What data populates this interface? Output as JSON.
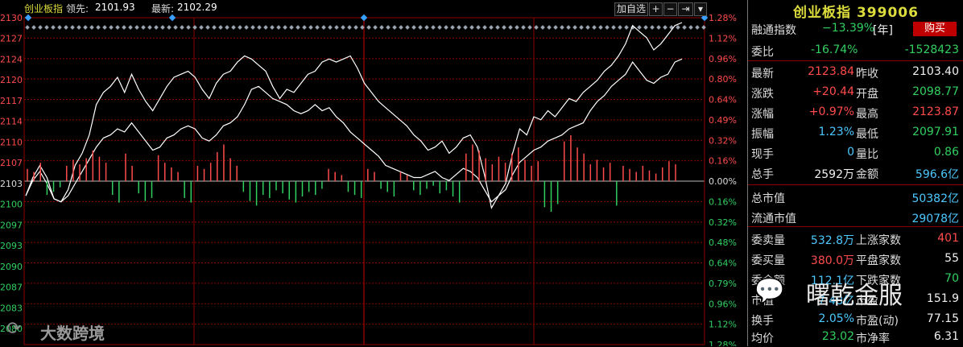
{
  "header": {
    "index_name": "创业板指",
    "leader_label": "领先:",
    "leader_value": "2101.93",
    "latest_label": "最新:",
    "latest_value": "2102.29",
    "add_button": "加自选",
    "plus_button": "+",
    "minus_button": "−",
    "next_button": "⇥",
    "dropdown_button": "▾"
  },
  "chart_data": {
    "type": "line",
    "title": "",
    "prev_close": 2103.4,
    "y_left_ticks": [
      "2130",
      "2127",
      "2124",
      "2120",
      "2117",
      "2114",
      "2110",
      "2107",
      "2103",
      "2100",
      "2097",
      "2093",
      "2090",
      "2087",
      "2083",
      "2080"
    ],
    "y_right_ticks": [
      "1.28%",
      "1.12%",
      "0.96%",
      "0.80%",
      "0.64%",
      "0.49%",
      "0.32%",
      "0.16%",
      "0.00%",
      "0.16%",
      "0.32%",
      "0.48%",
      "0.64%",
      "0.79%",
      "0.96%",
      "1.12%",
      "1.28%"
    ],
    "ylim": [
      2076.5,
      2130.3
    ],
    "x_count": 240,
    "series": [
      {
        "name": "",
        "color": "#ffffff",
        "values": [
          2101.0,
          2104.0,
          2106.0,
          2104.0,
          2100.5,
          2100.0,
          2102.0,
          2106.0,
          2108.0,
          2111.0,
          2116.0,
          2118.0,
          2119.0,
          2120.5,
          2118.0,
          2121.0,
          2118.5,
          2116.5,
          2115.0,
          2117.0,
          2119.0,
          2120.5,
          2121.0,
          2121.5,
          2120.5,
          2118.5,
          2117.0,
          2119.5,
          2121.0,
          2121.5,
          2123.0,
          2124.0,
          2123.5,
          2122.5,
          2121.5,
          2119.0,
          2117.0,
          2118.5,
          2118.0,
          2119.5,
          2121.0,
          2121.5,
          2123.0,
          2123.5,
          2123.0,
          2123.5,
          2124.0,
          2122.0,
          2119.5,
          2118.0,
          2116.5,
          2115.5,
          2114.5,
          2113.5,
          2112.5,
          2111.0,
          2110.0,
          2108.5,
          2109.0,
          2110.0,
          2108.0,
          2109.0,
          2110.5,
          2111.0,
          2109.0,
          2104.5,
          2099.0,
          2101.0,
          2103.0,
          2108.0,
          2112.0,
          2111.0,
          2114.0,
          2113.5,
          2115.0,
          2114.0,
          2115.5,
          2117.0,
          2116.5,
          2118.0,
          2119.0,
          2120.0,
          2121.5,
          2122.5,
          2124.0,
          2126.0,
          2129.0,
          2128.0,
          2127.0,
          2125.0,
          2126.0,
          2127.5,
          2129.0,
          2129.5
        ]
      },
      {
        "name": "",
        "color": "#ffffff",
        "values": [
          2101.0,
          2103.5,
          2105.0,
          2103.0,
          2100.5,
          2100.0,
          2101.0,
          2103.0,
          2105.0,
          2107.0,
          2109.0,
          2110.5,
          2111.0,
          2112.0,
          2111.5,
          2113.0,
          2111.5,
          2110.0,
          2108.5,
          2109.0,
          2110.5,
          2111.0,
          2112.0,
          2112.5,
          2112.0,
          2110.5,
          2110.0,
          2111.0,
          2112.5,
          2113.0,
          2114.0,
          2116.0,
          2118.5,
          2119.0,
          2118.0,
          2117.0,
          2116.5,
          2116.0,
          2115.0,
          2114.5,
          2115.0,
          2116.0,
          2115.0,
          2115.5,
          2114.0,
          2113.0,
          2111.5,
          2110.5,
          2109.5,
          2108.5,
          2107.5,
          2106.0,
          2105.5,
          2105.0,
          2104.5,
          2104.0,
          2104.0,
          2104.5,
          2105.0,
          2104.0,
          2103.5,
          2104.5,
          2105.5,
          2105.0,
          2104.0,
          2102.0,
          2100.0,
          2101.0,
          2102.0,
          2104.5,
          2106.5,
          2107.5,
          2108.5,
          2109.0,
          2110.0,
          2110.5,
          2111.0,
          2112.0,
          2112.5,
          2113.0,
          2115.0,
          2116.5,
          2117.5,
          2119.0,
          2120.0,
          2121.0,
          2123.0,
          2121.5,
          2120.0,
          2119.5,
          2120.5,
          2121.0,
          2123.0,
          2123.5
        ]
      }
    ],
    "volume": [
      8,
      6,
      12,
      9,
      7,
      4,
      10,
      14,
      11,
      15,
      20,
      16,
      12,
      9,
      14,
      18,
      10,
      8,
      13,
      11,
      17,
      12,
      9,
      6,
      11,
      14,
      10,
      8,
      12,
      19,
      24,
      15,
      10,
      7,
      13,
      16,
      9,
      11,
      6,
      8,
      12,
      14,
      10,
      7,
      9,
      5,
      8,
      6,
      4,
      7,
      9,
      11,
      8,
      6,
      5,
      7,
      10,
      6,
      4,
      6,
      9,
      5,
      3,
      8,
      6,
      10,
      14,
      18,
      24,
      20,
      15,
      11,
      16,
      12,
      18,
      22,
      14,
      10,
      13,
      17,
      20,
      15,
      26,
      30,
      22,
      18,
      11,
      14,
      9,
      12,
      16,
      10,
      8,
      6,
      10,
      7,
      5,
      9,
      13,
      11
    ],
    "volume_sign": [
      1,
      1,
      1,
      -1,
      -1,
      -1,
      1,
      1,
      1,
      1,
      1,
      1,
      1,
      -1,
      -1,
      1,
      1,
      -1,
      -1,
      -1,
      1,
      1,
      1,
      1,
      -1,
      -1,
      1,
      1,
      1,
      1,
      1,
      1,
      1,
      -1,
      -1,
      -1,
      -1,
      -1,
      -1,
      -1,
      -1,
      -1,
      -1,
      -1,
      -1,
      -1,
      1,
      1,
      1,
      -1,
      -1,
      -1,
      1,
      1,
      -1,
      -1,
      -1,
      1,
      1,
      -1,
      -1,
      -1,
      -1,
      -1,
      -1,
      -1,
      -1,
      1,
      1,
      1,
      1,
      1,
      1,
      1,
      1,
      1,
      1,
      1,
      1,
      -1,
      -1,
      -1,
      1,
      1,
      1,
      1,
      1,
      1,
      1,
      1,
      -1,
      1,
      1,
      1,
      1,
      1,
      1,
      1,
      1,
      1
    ]
  },
  "panel": {
    "title": "创业板指 399006",
    "rows": [
      {
        "l1": "融通指数",
        "v1": "−13.39%",
        "u1": "[年]",
        "buy": "购买"
      },
      {
        "l1": "委比",
        "v1": "-16.74%",
        "v2": "-1528423"
      },
      {
        "l1": "最新",
        "v1": "2123.84",
        "l2": "昨收",
        "v2": "2103.40"
      },
      {
        "l1": "涨跌",
        "v1": "+20.44",
        "l2": "开盘",
        "v2": "2098.77"
      },
      {
        "l1": "涨幅",
        "v1": "+0.97%",
        "l2": "最高",
        "v2": "2123.87"
      },
      {
        "l1": "振幅",
        "v1": "1.23%",
        "l2": "最低",
        "v2": "2097.91"
      },
      {
        "l1": "现手",
        "v1": "0",
        "l2": "量比",
        "v2": "0.86"
      },
      {
        "l1": "总手",
        "v1": "2592万",
        "l2": "金额",
        "v2": "596.6亿"
      },
      {
        "l1": "总市值",
        "v2": "50382亿"
      },
      {
        "l1": "流通市值",
        "v2": "29078亿"
      },
      {
        "l1": "委卖量",
        "v1": "532.8万",
        "l2": "上涨家数",
        "v2": "401"
      },
      {
        "l1": "委买量",
        "v1": "380.0万",
        "l2": "平盘家数",
        "v2": "55"
      },
      {
        "l1": "委金额",
        "v1": "112.1亿",
        "l2": "下跌家数",
        "v2": "70"
      },
      {
        "l1": "市值",
        "v1": "7.48亿",
        "l2": "市盈",
        "v2": "151.9"
      },
      {
        "l1": "换手",
        "v1": "2.05%",
        "l2": "市盈(动)",
        "v2": "77.15"
      },
      {
        "l1": "均价",
        "v1": "23.02",
        "l2": "市净率",
        "v2": "6.31"
      }
    ]
  },
  "watermarks": {
    "left": "大数跨境",
    "right": "曙乾金服"
  },
  "colors": {
    "up": "#ff4b4b",
    "down": "#30d060",
    "grid": "#8b0000",
    "title_yellow": "#dcdc3c"
  }
}
